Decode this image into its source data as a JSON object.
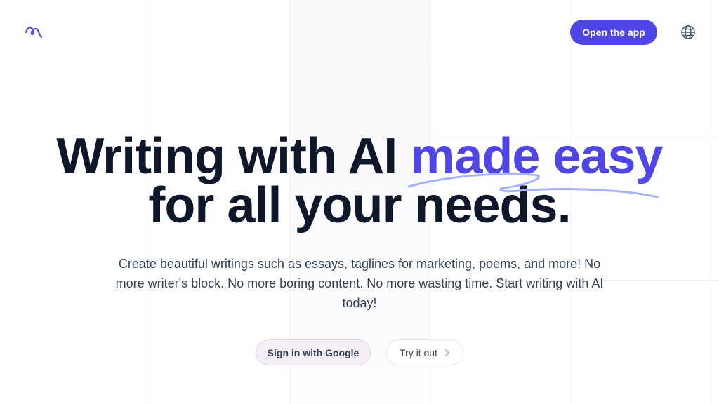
{
  "header": {
    "logo_icon": "squiggle-logo-icon",
    "open_app_label": "Open the app",
    "language_icon": "globe-icon"
  },
  "hero": {
    "headline_part1": "Writing with AI ",
    "headline_accent": "made easy",
    "headline_line2": "for all your needs.",
    "subtext": "Create beautiful writings such as essays, taglines for marketing, poems, and more! No more writer's block. No more boring content. No more wasting time. Start writing with AI today!"
  },
  "actions": {
    "google_label": "Sign in with Google",
    "try_label": "Try it out",
    "try_icon": "chevron-right-icon"
  },
  "colors": {
    "accent": "#4f46e5",
    "text": "#0f172a",
    "muted": "#334155",
    "google_bg": "#f5eef6"
  }
}
